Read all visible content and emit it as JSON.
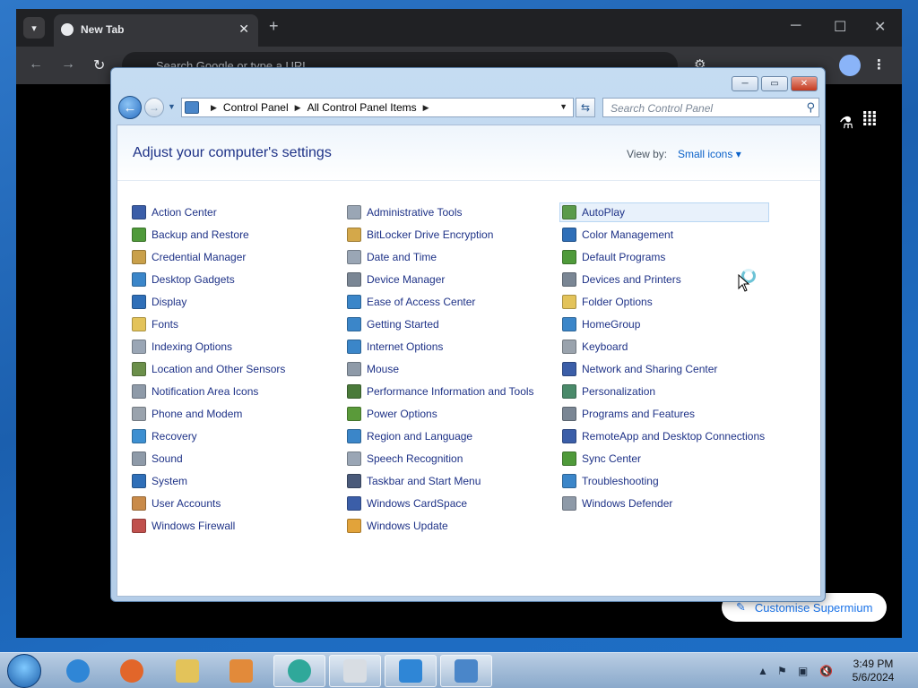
{
  "browser": {
    "tab_title": "New Tab",
    "tab_close": "✕",
    "new_tab": "+",
    "omnibox_placeholder": "Search Google or type a URL",
    "customise_label": "Customise Supermium"
  },
  "window": {
    "minimize": "─",
    "maximize": "▭",
    "close": "✕"
  },
  "address_bar": {
    "breadcrumbs": [
      "Control Panel",
      "All Control Panel Items"
    ]
  },
  "search": {
    "placeholder": "Search Control Panel"
  },
  "content": {
    "title": "Adjust your computer's settings",
    "view_by_label": "View by:",
    "view_by_value": "Small icons ▾"
  },
  "items": {
    "col1": [
      {
        "label": "Action Center",
        "color": "#3b5ea8"
      },
      {
        "label": "Backup and Restore",
        "color": "#4f9a3a"
      },
      {
        "label": "Credential Manager",
        "color": "#c9a04a"
      },
      {
        "label": "Desktop Gadgets",
        "color": "#3b86c9"
      },
      {
        "label": "Display",
        "color": "#2f6fb8"
      },
      {
        "label": "Fonts",
        "color": "#e3c35a"
      },
      {
        "label": "Indexing Options",
        "color": "#9aa6b5"
      },
      {
        "label": "Location and Other Sensors",
        "color": "#6b8f4a"
      },
      {
        "label": "Notification Area Icons",
        "color": "#8e9aa8"
      },
      {
        "label": "Phone and Modem",
        "color": "#9aa3ad"
      },
      {
        "label": "Recovery",
        "color": "#3d8fd1"
      },
      {
        "label": "Sound",
        "color": "#8e9aa8"
      },
      {
        "label": "System",
        "color": "#2f6fb8"
      },
      {
        "label": "User Accounts",
        "color": "#c98b4a"
      },
      {
        "label": "Windows Firewall",
        "color": "#c0504d"
      }
    ],
    "col2": [
      {
        "label": "Administrative Tools",
        "color": "#9aa6b5"
      },
      {
        "label": "BitLocker Drive Encryption",
        "color": "#d4a84a"
      },
      {
        "label": "Date and Time",
        "color": "#9aa6b5"
      },
      {
        "label": "Device Manager",
        "color": "#7a8694"
      },
      {
        "label": "Ease of Access Center",
        "color": "#3b86c9"
      },
      {
        "label": "Getting Started",
        "color": "#3b86c9"
      },
      {
        "label": "Internet Options",
        "color": "#3b86c9"
      },
      {
        "label": "Mouse",
        "color": "#8e9aa8"
      },
      {
        "label": "Performance Information and Tools",
        "color": "#4a7a3a"
      },
      {
        "label": "Power Options",
        "color": "#5a9a3a"
      },
      {
        "label": "Region and Language",
        "color": "#3b86c9"
      },
      {
        "label": "Speech Recognition",
        "color": "#9aa6b5"
      },
      {
        "label": "Taskbar and Start Menu",
        "color": "#4a5a7a"
      },
      {
        "label": "Windows CardSpace",
        "color": "#3b5ea8"
      },
      {
        "label": "Windows Update",
        "color": "#e2a33a"
      }
    ],
    "col3": [
      {
        "label": "AutoPlay",
        "color": "#5a9a4a"
      },
      {
        "label": "Color Management",
        "color": "#2f6fb8"
      },
      {
        "label": "Default Programs",
        "color": "#4f9a3a"
      },
      {
        "label": "Devices and Printers",
        "color": "#7a8694"
      },
      {
        "label": "Folder Options",
        "color": "#e3c35a"
      },
      {
        "label": "HomeGroup",
        "color": "#3b86c9"
      },
      {
        "label": "Keyboard",
        "color": "#9aa3ad"
      },
      {
        "label": "Network and Sharing Center",
        "color": "#3b5ea8"
      },
      {
        "label": "Personalization",
        "color": "#4a8a6a"
      },
      {
        "label": "Programs and Features",
        "color": "#7a8694"
      },
      {
        "label": "RemoteApp and Desktop Connections",
        "color": "#3b5ea8"
      },
      {
        "label": "Sync Center",
        "color": "#4f9a3a"
      },
      {
        "label": "Troubleshooting",
        "color": "#3b86c9"
      },
      {
        "label": "Windows Defender",
        "color": "#8e9aa8"
      }
    ]
  },
  "taskbar": {
    "time": "3:49 PM",
    "date": "5/6/2024",
    "apps": [
      {
        "name": "internet-explorer",
        "color": "#2f86d6"
      },
      {
        "name": "firefox",
        "color": "#e2662a"
      },
      {
        "name": "file-explorer",
        "color": "#e3c35a"
      },
      {
        "name": "media-player",
        "color": "#e28a3a"
      },
      {
        "name": "supermium",
        "color": "#2fa89a"
      },
      {
        "name": "blank-app",
        "color": "#d8dde3"
      },
      {
        "name": "roblox-studio",
        "color": "#2f86d6"
      },
      {
        "name": "control-panel",
        "color": "#4a86c9"
      }
    ]
  }
}
